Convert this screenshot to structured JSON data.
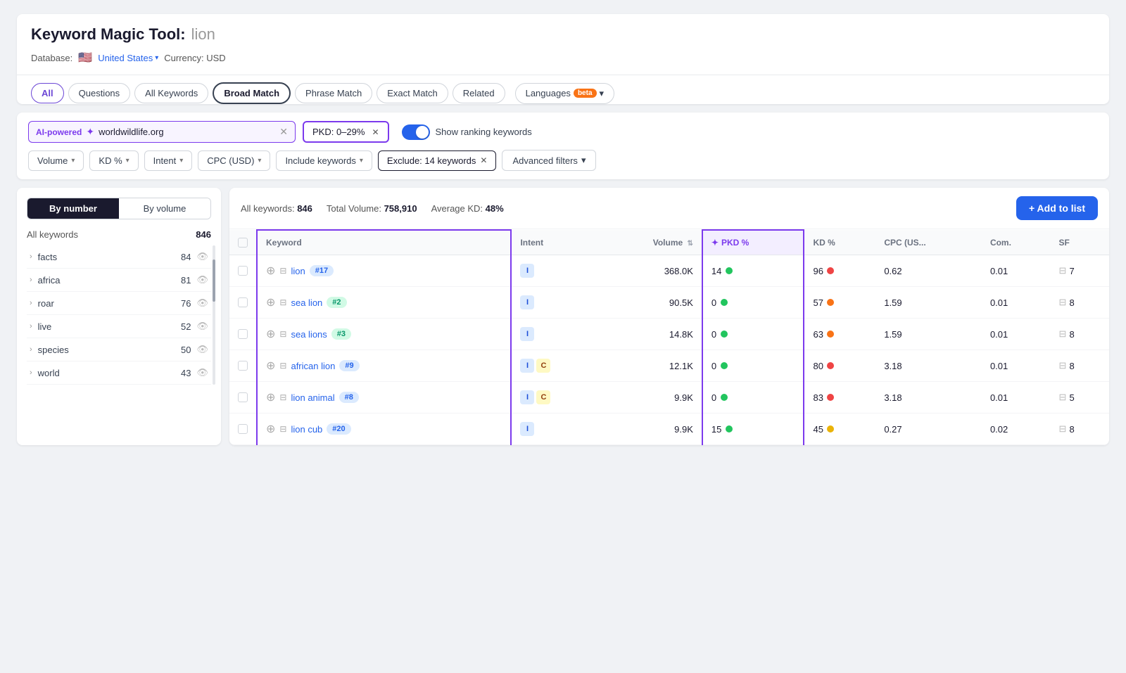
{
  "page": {
    "title_main": "Keyword Magic Tool:",
    "title_keyword": "lion",
    "database_label": "Database:",
    "database_country": "United States",
    "currency_label": "Currency: USD"
  },
  "tabs": [
    {
      "id": "all",
      "label": "All",
      "active": true
    },
    {
      "id": "questions",
      "label": "Questions",
      "active": false
    },
    {
      "id": "all-keywords",
      "label": "All Keywords",
      "active": false
    },
    {
      "id": "broad-match",
      "label": "Broad Match",
      "active": false,
      "selected": true
    },
    {
      "id": "phrase-match",
      "label": "Phrase Match",
      "active": false
    },
    {
      "id": "exact-match",
      "label": "Exact Match",
      "active": false
    },
    {
      "id": "related",
      "label": "Related",
      "active": false
    },
    {
      "id": "languages",
      "label": "Languages",
      "active": false,
      "beta": true
    }
  ],
  "filters": {
    "ai_input_value": "worldwildlife.org",
    "ai_powered_label": "AI-powered",
    "pkd_filter": "PKD: 0–29%",
    "show_ranking_label": "Show ranking keywords",
    "volume_label": "Volume",
    "kd_label": "KD %",
    "intent_label": "Intent",
    "cpc_label": "CPC (USD)",
    "include_label": "Include keywords",
    "exclude_label": "Exclude: 14 keywords",
    "advanced_label": "Advanced filters"
  },
  "sidebar": {
    "sort_by_number": "By number",
    "sort_by_volume": "By volume",
    "all_keywords_label": "All keywords",
    "all_keywords_count": "846",
    "items": [
      {
        "name": "facts",
        "count": "84"
      },
      {
        "name": "africa",
        "count": "81"
      },
      {
        "name": "roar",
        "count": "76"
      },
      {
        "name": "live",
        "count": "52"
      },
      {
        "name": "species",
        "count": "50"
      },
      {
        "name": "world",
        "count": "43"
      }
    ]
  },
  "table": {
    "stats_keywords_label": "All keywords:",
    "stats_keywords_count": "846",
    "stats_volume_label": "Total Volume:",
    "stats_volume_value": "758,910",
    "stats_kd_label": "Average KD:",
    "stats_kd_value": "48%",
    "add_to_list_label": "+ Add to list",
    "columns": [
      "",
      "Keyword",
      "Intent",
      "Volume",
      "PKD %",
      "KD %",
      "CPC (US...",
      "Com.",
      "SF"
    ],
    "rows": [
      {
        "keyword": "lion",
        "rank": "#17",
        "rank_color": "blue",
        "intents": [
          "I"
        ],
        "volume": "368.0K",
        "pkd": "14",
        "pkd_dot": "green",
        "kd": "96",
        "kd_dot": "red",
        "cpc": "0.62",
        "com": "0.01",
        "sf": "7"
      },
      {
        "keyword": "sea lion",
        "rank": "#2",
        "rank_color": "teal",
        "intents": [
          "I"
        ],
        "volume": "90.5K",
        "pkd": "0",
        "pkd_dot": "green",
        "kd": "57",
        "kd_dot": "orange",
        "cpc": "1.59",
        "com": "0.01",
        "sf": "8"
      },
      {
        "keyword": "sea lions",
        "rank": "#3",
        "rank_color": "teal",
        "intents": [
          "I"
        ],
        "volume": "14.8K",
        "pkd": "0",
        "pkd_dot": "green",
        "kd": "63",
        "kd_dot": "orange",
        "cpc": "1.59",
        "com": "0.01",
        "sf": "8"
      },
      {
        "keyword": "african lion",
        "rank": "#9",
        "rank_color": "blue",
        "intents": [
          "I",
          "C"
        ],
        "volume": "12.1K",
        "pkd": "0",
        "pkd_dot": "green",
        "kd": "80",
        "kd_dot": "red",
        "cpc": "3.18",
        "com": "0.01",
        "sf": "8"
      },
      {
        "keyword": "lion animal",
        "rank": "#8",
        "rank_color": "blue",
        "intents": [
          "I",
          "C"
        ],
        "volume": "9.9K",
        "pkd": "0",
        "pkd_dot": "green",
        "kd": "83",
        "kd_dot": "red",
        "cpc": "3.18",
        "com": "0.01",
        "sf": "5"
      },
      {
        "keyword": "lion cub",
        "rank": "#20",
        "rank_color": "blue",
        "intents": [
          "I"
        ],
        "volume": "9.9K",
        "pkd": "15",
        "pkd_dot": "green",
        "kd": "45",
        "kd_dot": "yellow",
        "cpc": "0.27",
        "com": "0.02",
        "sf": "8"
      }
    ]
  }
}
